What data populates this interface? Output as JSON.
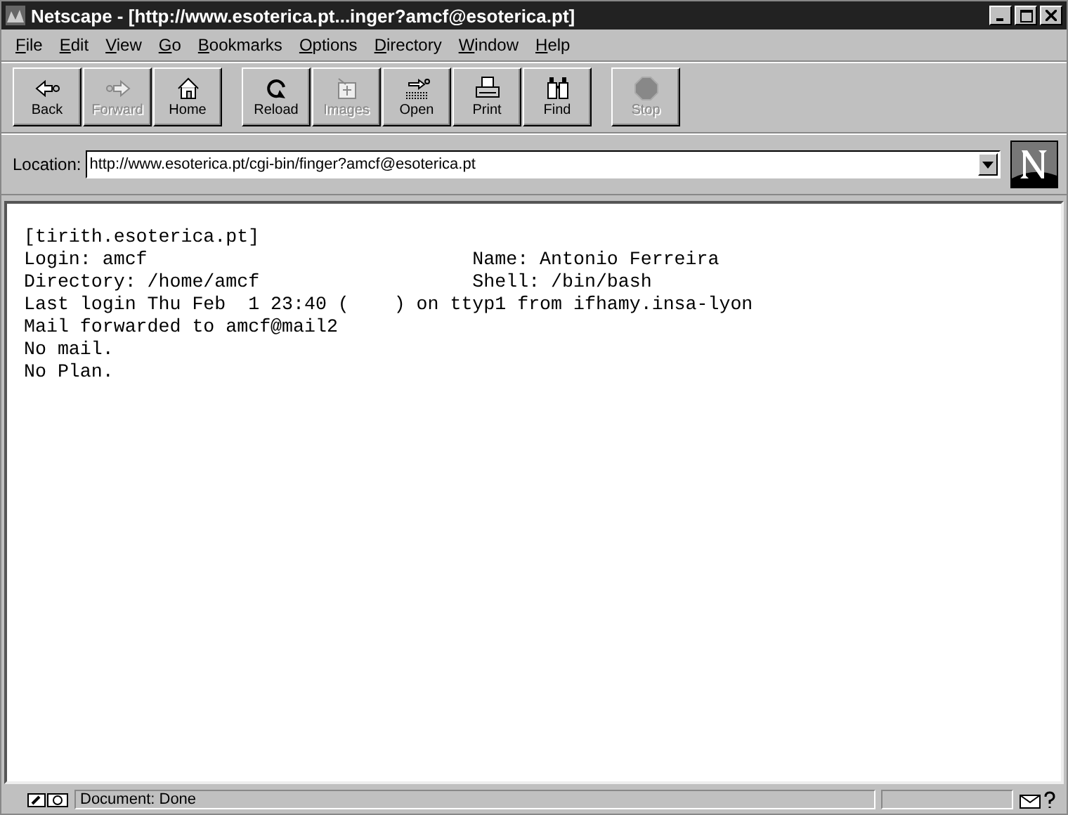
{
  "window": {
    "title": "Netscape - [http://www.esoterica.pt...inger?amcf@esoterica.pt]"
  },
  "menu": [
    "File",
    "Edit",
    "View",
    "Go",
    "Bookmarks",
    "Options",
    "Directory",
    "Window",
    "Help"
  ],
  "toolbar": {
    "groups": [
      [
        {
          "label": "Back",
          "disabled": false
        },
        {
          "label": "Forward",
          "disabled": true
        },
        {
          "label": "Home",
          "disabled": false
        }
      ],
      [
        {
          "label": "Reload",
          "disabled": false
        },
        {
          "label": "Images",
          "disabled": true
        },
        {
          "label": "Open",
          "disabled": false
        },
        {
          "label": "Print",
          "disabled": false
        },
        {
          "label": "Find",
          "disabled": false
        }
      ],
      [
        {
          "label": "Stop",
          "disabled": true
        }
      ]
    ]
  },
  "location": {
    "label": "Location:",
    "value": "http://www.esoterica.pt/cgi-bin/finger?amcf@esoterica.pt"
  },
  "content": {
    "lines": [
      "[tirith.esoterica.pt]",
      "Login: amcf                             Name: Antonio Ferreira",
      "Directory: /home/amcf                   Shell: /bin/bash",
      "Last login Thu Feb  1 23:40 (    ) on ttyp1 from ifhamy.insa-lyon",
      "Mail forwarded to amcf@mail2",
      "No mail.",
      "No Plan."
    ]
  },
  "status_bar": {
    "text": "Document: Done"
  }
}
